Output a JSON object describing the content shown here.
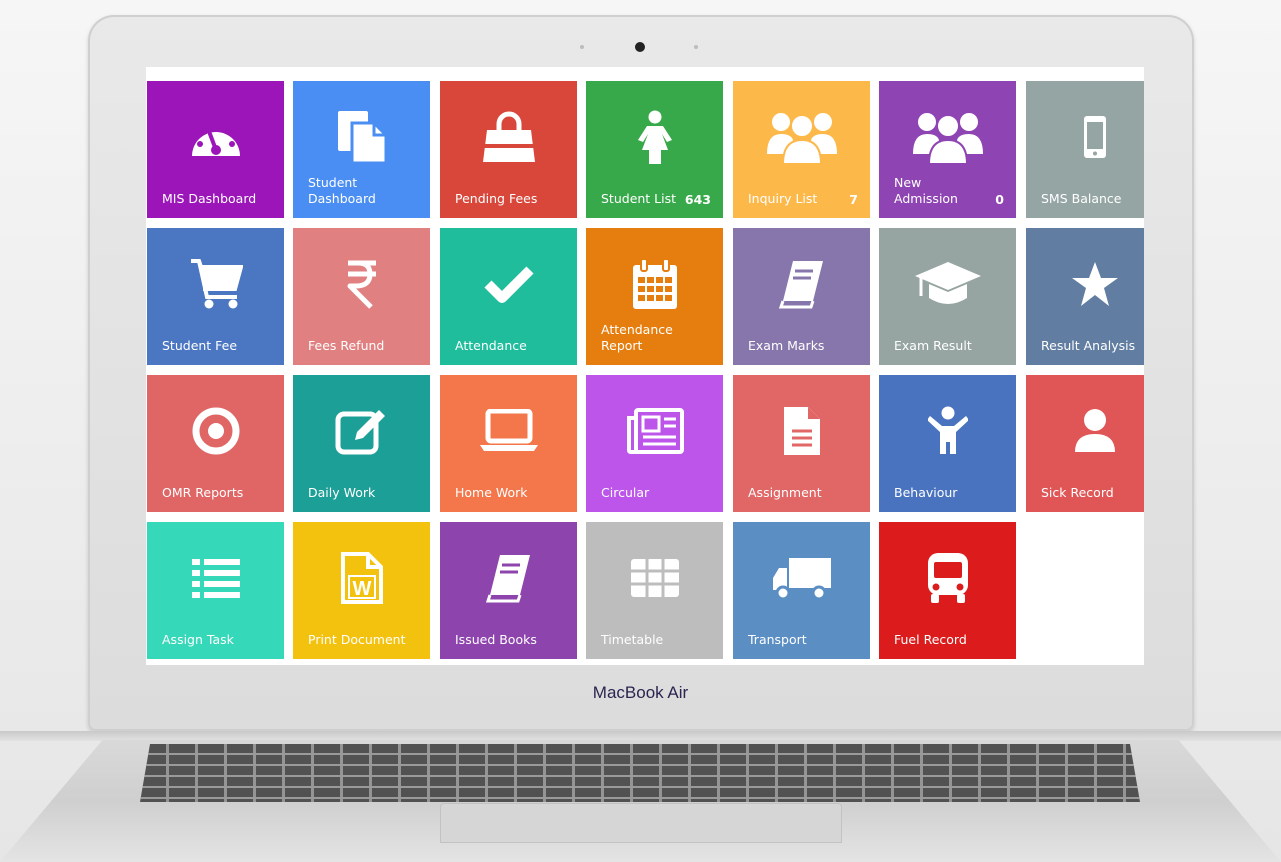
{
  "brand": "MacBook Air",
  "tiles": [
    {
      "label": "MIS Dashboard",
      "count": "",
      "icon": "gauge-icon",
      "color": "#9b15b8"
    },
    {
      "label": "Student\nDashboard",
      "count": "",
      "icon": "documents-icon",
      "color": "#4a8ef3"
    },
    {
      "label": "Pending Fees",
      "count": "",
      "icon": "shopping-bag-icon",
      "color": "#d9473a"
    },
    {
      "label": "Student List",
      "count": "643",
      "icon": "female-icon",
      "color": "#38a94a"
    },
    {
      "label": "Inquiry List",
      "count": "7",
      "icon": "users-icon",
      "color": "#fdb84a"
    },
    {
      "label": "New\nAdmission",
      "count": "0",
      "icon": "group-icon",
      "color": "#8f44b3"
    },
    {
      "label": "SMS Balance",
      "count": "",
      "icon": "mobile-icon",
      "color": "#95a5a3"
    },
    {
      "label": "Student Fee",
      "count": "",
      "icon": "cart-icon",
      "color": "#4a76c2"
    },
    {
      "label": "Fees Refund",
      "count": "",
      "icon": "rupee-icon",
      "color": "#e08080"
    },
    {
      "label": "Attendance",
      "count": "",
      "icon": "check-icon",
      "color": "#1fbd9c"
    },
    {
      "label": "Attendance\nReport",
      "count": "",
      "icon": "calendar-icon",
      "color": "#e67e0f"
    },
    {
      "label": "Exam Marks",
      "count": "",
      "icon": "book-icon",
      "color": "#8776ab"
    },
    {
      "label": "Exam Result",
      "count": "",
      "icon": "graduation-cap-icon",
      "color": "#96a5a2"
    },
    {
      "label": "Result Analysis",
      "count": "",
      "icon": "star-icon",
      "color": "#617da1"
    },
    {
      "label": "OMR Reports",
      "count": "",
      "icon": "target-icon",
      "color": "#e06565"
    },
    {
      "label": "Daily Work",
      "count": "",
      "icon": "edit-icon",
      "color": "#1b9f96"
    },
    {
      "label": "Home Work",
      "count": "",
      "icon": "laptop-icon",
      "color": "#f3774a"
    },
    {
      "label": "Circular",
      "count": "",
      "icon": "newspaper-icon",
      "color": "#bd55eb"
    },
    {
      "label": "Assignment",
      "count": "",
      "icon": "file-text-icon",
      "color": "#e16666"
    },
    {
      "label": "Behaviour",
      "count": "",
      "icon": "child-icon",
      "color": "#4a73bf"
    },
    {
      "label": "Sick Record",
      "count": "",
      "icon": "user-icon",
      "color": "#e05656"
    },
    {
      "label": "Assign Task",
      "count": "",
      "icon": "list-icon",
      "color": "#35d8b8"
    },
    {
      "label": "Print Document",
      "count": "",
      "icon": "word-file-icon",
      "color": "#f3c20f"
    },
    {
      "label": "Issued Books",
      "count": "",
      "icon": "book-icon",
      "color": "#8e44ad"
    },
    {
      "label": "Timetable",
      "count": "",
      "icon": "table-icon",
      "color": "#bdbdbd"
    },
    {
      "label": "Transport",
      "count": "",
      "icon": "truck-icon",
      "color": "#5b8fc4"
    },
    {
      "label": "Fuel Record",
      "count": "",
      "icon": "bus-icon",
      "color": "#dc1c1c"
    }
  ]
}
